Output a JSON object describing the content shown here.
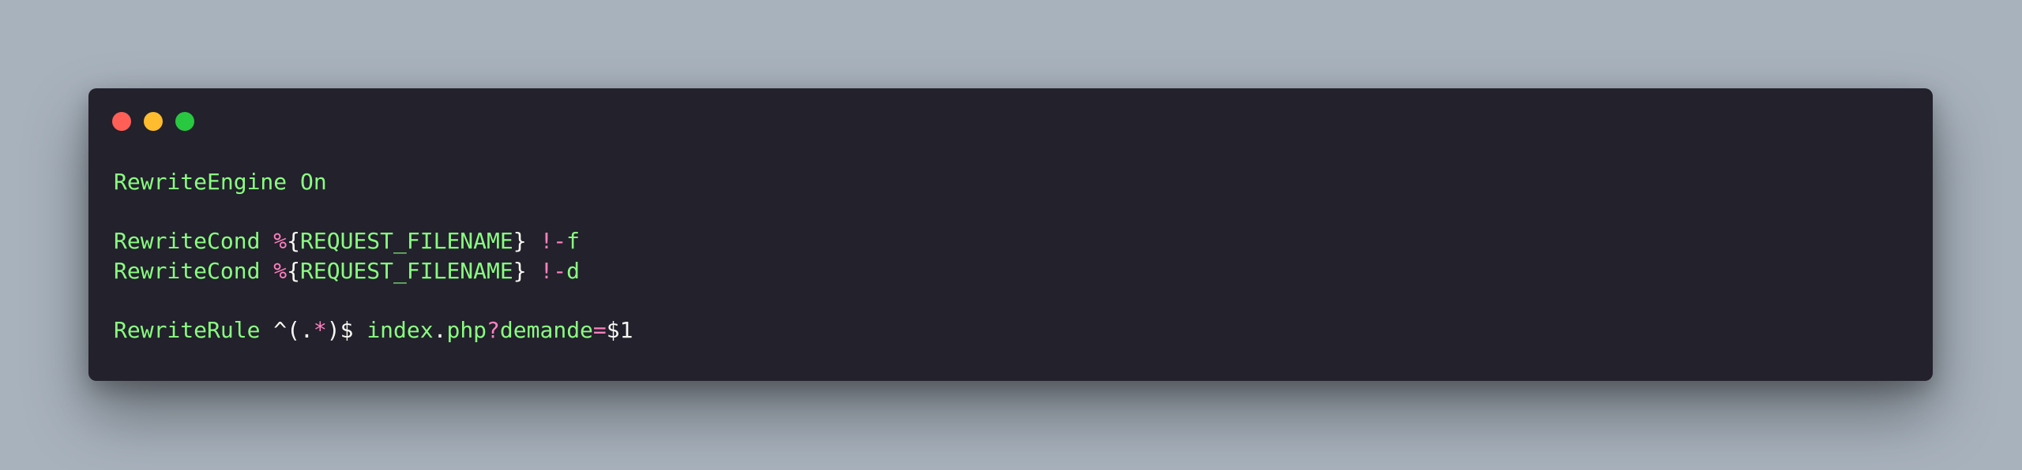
{
  "window": {
    "background": "#22212c",
    "page_background": "#a8b2bd",
    "controls": [
      {
        "name": "close",
        "color": "#ff5f57"
      },
      {
        "name": "minimize",
        "color": "#febc2e"
      },
      {
        "name": "maximize",
        "color": "#28c840"
      }
    ]
  },
  "colors": {
    "keyword": "#8aff80",
    "operator": "#ff80bf",
    "plain": "#f8f8f2"
  },
  "code": {
    "lines": [
      [
        {
          "text": "RewriteEngine On",
          "kind": "keyword"
        }
      ],
      [],
      [
        {
          "text": "RewriteCond ",
          "kind": "keyword"
        },
        {
          "text": "%",
          "kind": "operator"
        },
        {
          "text": "{",
          "kind": "plain"
        },
        {
          "text": "REQUEST_FILENAME",
          "kind": "keyword"
        },
        {
          "text": "} ",
          "kind": "plain"
        },
        {
          "text": "!-",
          "kind": "operator"
        },
        {
          "text": "f",
          "kind": "keyword"
        }
      ],
      [
        {
          "text": "RewriteCond ",
          "kind": "keyword"
        },
        {
          "text": "%",
          "kind": "operator"
        },
        {
          "text": "{",
          "kind": "plain"
        },
        {
          "text": "REQUEST_FILENAME",
          "kind": "keyword"
        },
        {
          "text": "} ",
          "kind": "plain"
        },
        {
          "text": "!-",
          "kind": "operator"
        },
        {
          "text": "d",
          "kind": "keyword"
        }
      ],
      [],
      [
        {
          "text": "RewriteRule ",
          "kind": "keyword"
        },
        {
          "text": "^(.",
          "kind": "plain"
        },
        {
          "text": "*",
          "kind": "operator"
        },
        {
          "text": ")$ ",
          "kind": "plain"
        },
        {
          "text": "index",
          "kind": "keyword"
        },
        {
          "text": ".",
          "kind": "plain"
        },
        {
          "text": "php",
          "kind": "keyword"
        },
        {
          "text": "?",
          "kind": "operator"
        },
        {
          "text": "demande",
          "kind": "keyword"
        },
        {
          "text": "=",
          "kind": "operator"
        },
        {
          "text": "$1",
          "kind": "plain"
        }
      ]
    ]
  }
}
